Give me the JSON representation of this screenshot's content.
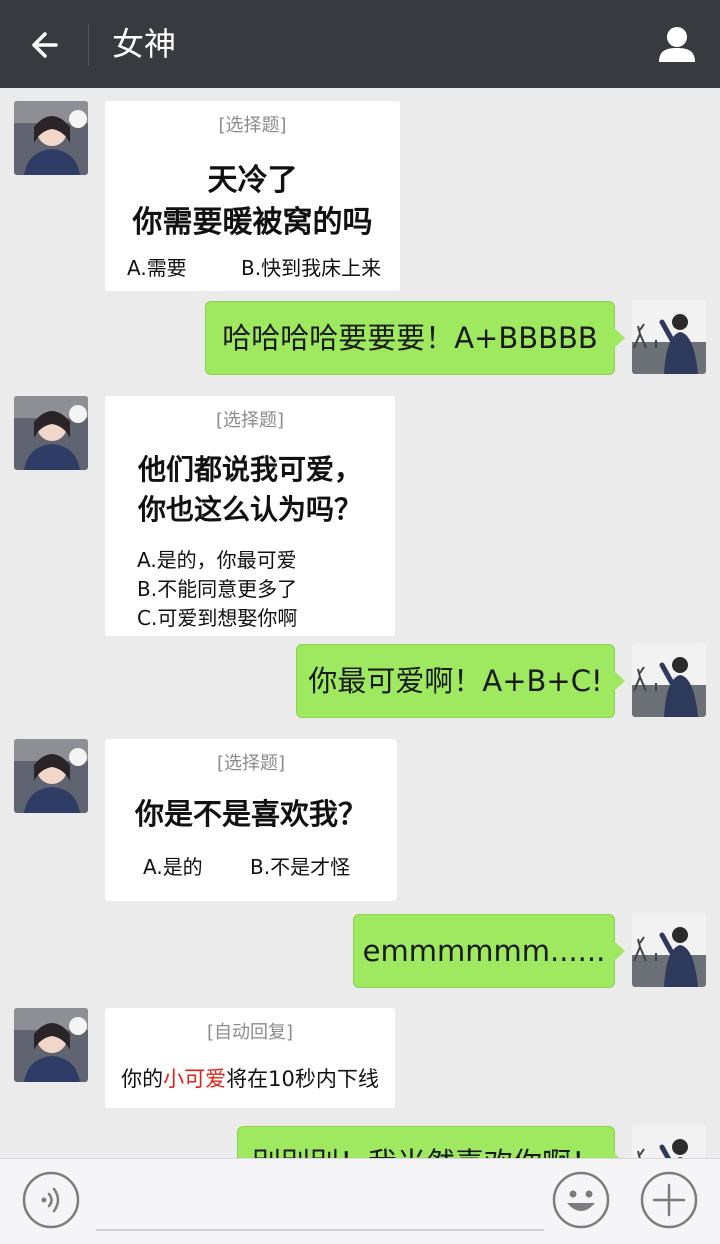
{
  "header": {
    "title": "女神"
  },
  "messages": {
    "m1": {
      "tag": "[选择题]",
      "q_line1": "天冷了",
      "q_line2": "你需要暖被窝的吗",
      "opt_a": "A.需要",
      "opt_b": "B.快到我床上来"
    },
    "r1": {
      "text": "哈哈哈哈要要要！A+BBBBB"
    },
    "m2": {
      "tag": "[选择题]",
      "q_line1": "他们都说我可爱，",
      "q_line2": "你也这么认为吗？",
      "opt_a": "A.是的，你最可爱",
      "opt_b": "B.不能同意更多了",
      "opt_c": "C.可爱到想娶你啊"
    },
    "r2": {
      "text": "你最可爱啊！A+B+C!"
    },
    "m3": {
      "tag": "[选择题]",
      "q_line1": "你是不是喜欢我？",
      "opt_a": "A.是的",
      "opt_b": "B.不是才怪"
    },
    "r3": {
      "text": "emmmmmm......"
    },
    "m4": {
      "tag": "[自动回复]",
      "text_pre": "你的",
      "text_hl": "小可爱",
      "text_post": "将在10秒内下线"
    },
    "r4": {
      "text": "别别别！我当然喜欢你啊！"
    }
  },
  "colors": {
    "topbar": "#393a3f",
    "bubble_green": "#9ee95f",
    "highlight_red": "#e0211d",
    "background": "#ebebeb"
  },
  "icons": [
    "back-arrow-icon",
    "profile-icon",
    "voice-icon",
    "emoji-icon",
    "plus-icon"
  ]
}
